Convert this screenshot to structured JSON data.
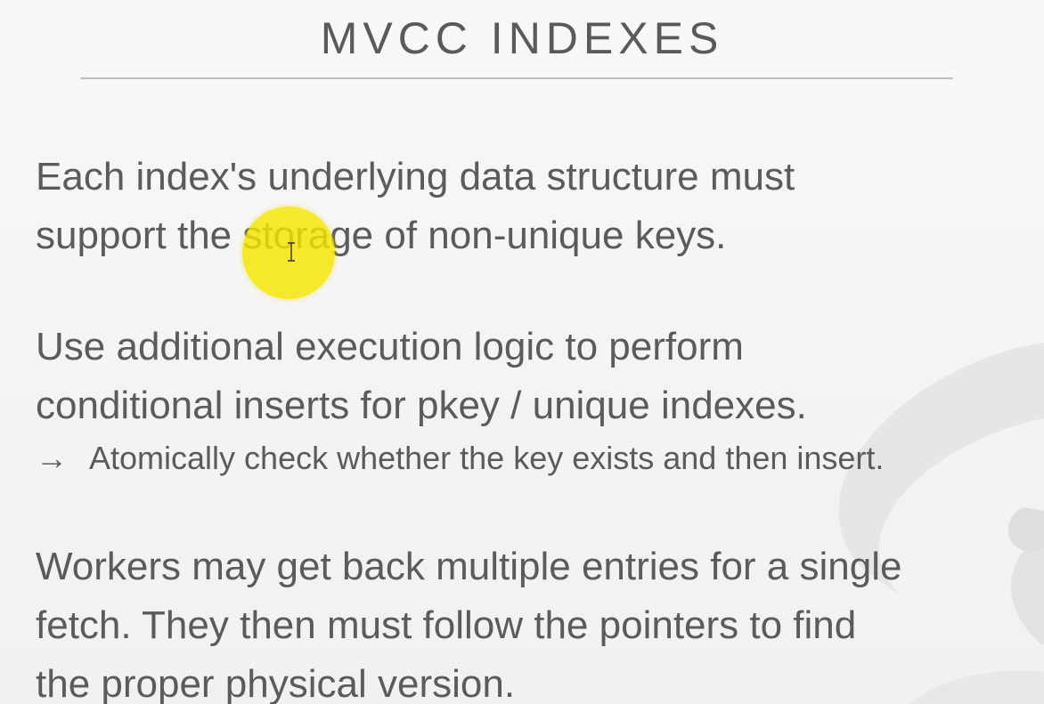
{
  "slide": {
    "title": "MVCC INDEXES",
    "paragraphs": [
      {
        "lines": [
          "Each index's underlying data structure must",
          "support the storage of non-unique keys."
        ]
      },
      {
        "lines": [
          "Use additional execution logic to perform",
          "conditional inserts for pkey / unique indexes."
        ],
        "sub_bullet": {
          "arrow": "→",
          "text": "Atomically check whether the key exists and then insert."
        }
      },
      {
        "lines": [
          "Workers may get back multiple entries for a single",
          "fetch. They then must follow the pointers to find",
          "the proper physical version."
        ]
      }
    ]
  },
  "colors": {
    "background": "#f6f6f6",
    "text": "#5b5b5b",
    "rule": "#bdbdbd",
    "highlight": "#f6e600",
    "watermark": "#e4e4e4"
  },
  "icons": {
    "cursor": "text-cursor-icon",
    "highlight": "cursor-highlight-icon",
    "arrow": "arrow-right-icon"
  }
}
